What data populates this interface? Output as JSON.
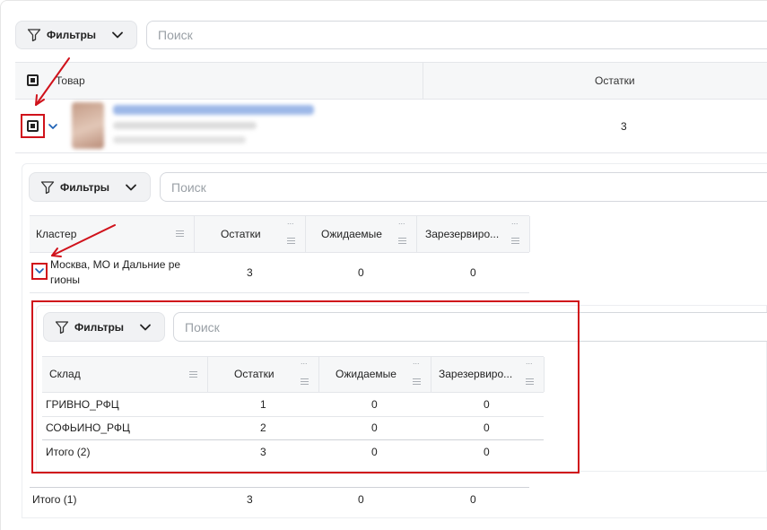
{
  "top": {
    "filter_label": "Фильтры",
    "search_placeholder": "Поиск"
  },
  "products_table": {
    "col_product": "Товар",
    "col_stock": "Остатки",
    "rows": [
      {
        "stock": "3"
      }
    ]
  },
  "cluster_section": {
    "filter_label": "Фильтры",
    "search_placeholder": "Поиск",
    "headers": [
      "Кластер",
      "Остатки",
      "Ожидаемые",
      "Зарезервиро..."
    ],
    "rows": [
      {
        "cluster_line1": "Москва, МО и Дальние ре",
        "cluster_line2": "гионы",
        "stock": "3",
        "expected": "0",
        "reserved": "0"
      }
    ],
    "total": {
      "label": "Итого (1)",
      "stock": "3",
      "expected": "0",
      "reserved": "0"
    }
  },
  "warehouse_section": {
    "filter_label": "Фильтры",
    "search_placeholder": "Поиск",
    "headers": [
      "Склад",
      "Остатки",
      "Ожидаемые",
      "Зарезервиро..."
    ],
    "rows": [
      {
        "name": "ГРИВНО_РФЦ",
        "stock": "1",
        "expected": "0",
        "reserved": "0"
      },
      {
        "name": "СОФЬИНО_РФЦ",
        "stock": "2",
        "expected": "0",
        "reserved": "0"
      }
    ],
    "total": {
      "label": "Итого (2)",
      "stock": "3",
      "expected": "0",
      "reserved": "0"
    }
  },
  "colors": {
    "highlight": "#d0121b",
    "expand_caret": "#1a5fb4",
    "header_bg": "#f6f7f8"
  },
  "column_menu_glyph": "..."
}
